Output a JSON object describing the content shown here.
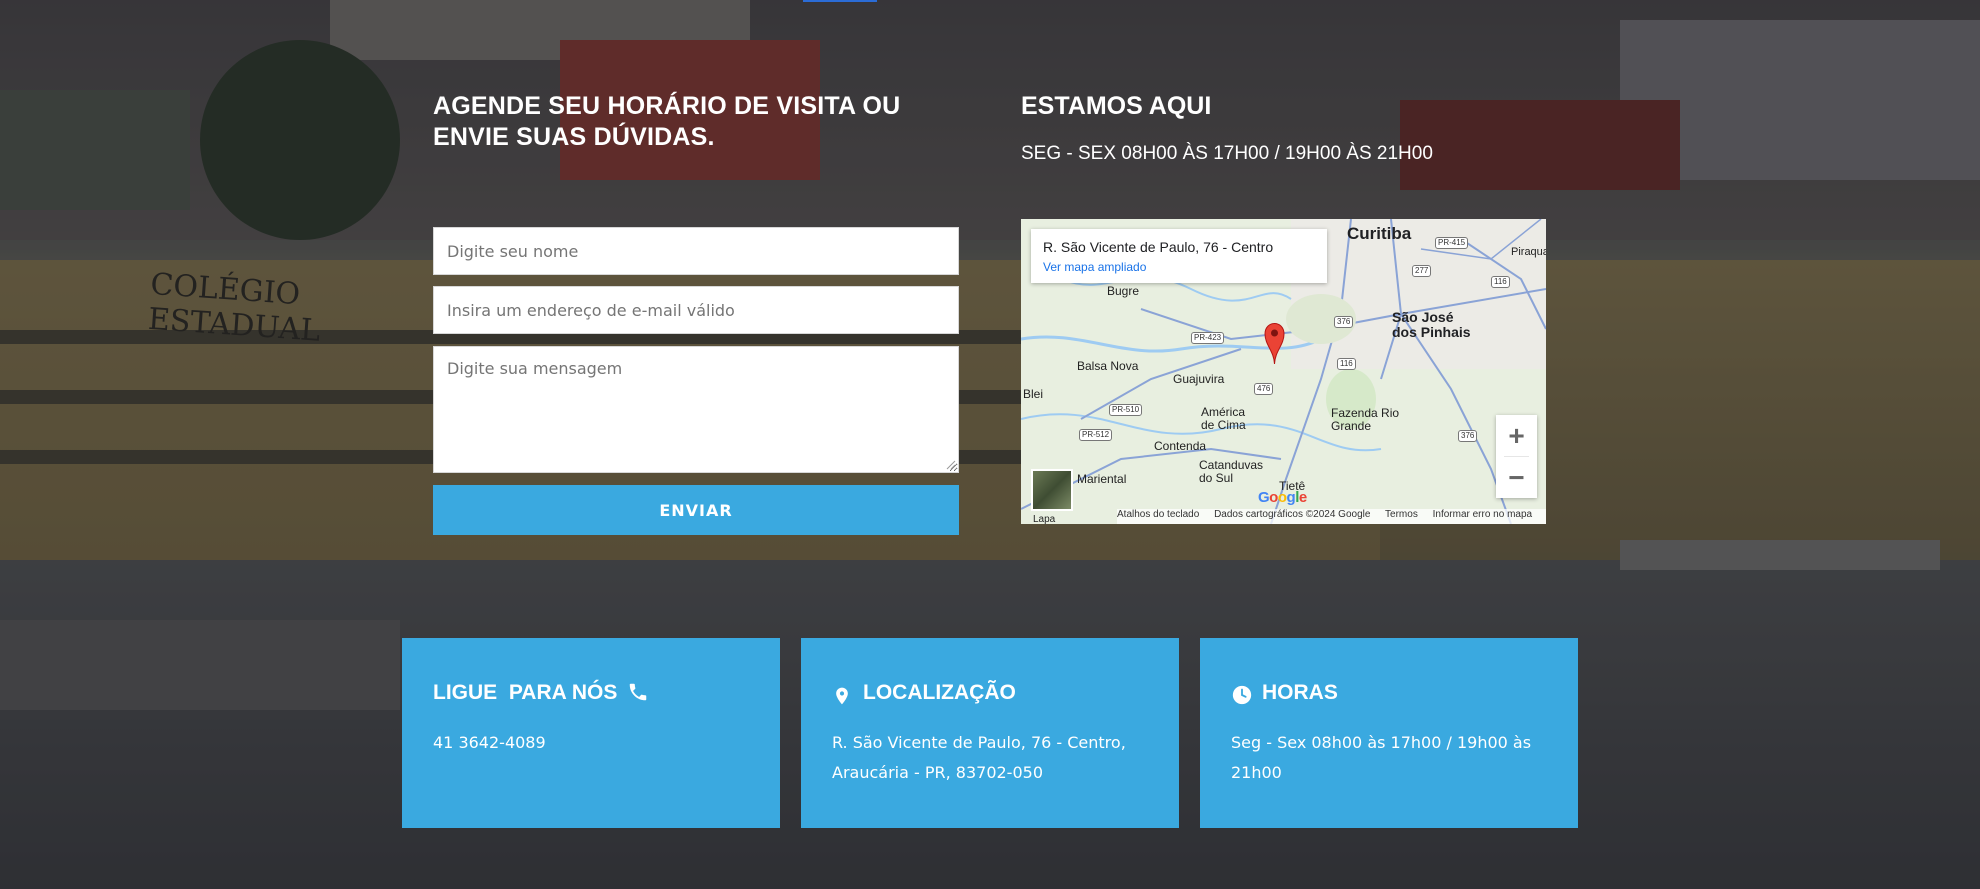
{
  "contact_form": {
    "heading": "AGENDE SEU HORÁRIO DE VISITA OU ENVIE SUAS DÚVIDAS.",
    "name_placeholder": "Digite seu nome",
    "email_placeholder": "Insira um endereço de e-mail válido",
    "message_placeholder": "Digite sua mensagem",
    "submit_label": "ENVIAR"
  },
  "location_section": {
    "heading": "ESTAMOS AQUI",
    "hours": "SEG - SEX 08H00 ÀS 17H00 / 19H00 ÀS 21H00"
  },
  "map": {
    "place_address": "R. São Vicente de Paulo, 76 - Centro",
    "enlarge_link": "Ver mapa ampliado",
    "zoom_in": "+",
    "zoom_out": "−",
    "labels": {
      "curitiba": "Curitiba",
      "sao_jose": "São José dos Pinhais",
      "bugre": "Bugre",
      "balsa_nova": "Balsa Nova",
      "guajuvira": "Guajuvira",
      "blei": "Blei",
      "america": "América de Cima",
      "fazenda": "Fazenda Rio Grande",
      "contenda": "Contenda",
      "mariental": "Mariental",
      "catanduvas": "Catanduvas do Sul",
      "tiete": "Tietê",
      "lapa": "Lapa",
      "piraqua": "Piraqua"
    },
    "shields": [
      "PR-415",
      "277",
      "116",
      "376",
      "PR-423",
      "116",
      "476",
      "PR-510",
      "PR-512",
      "376"
    ],
    "google_logo": "Google",
    "footer": {
      "shortcuts": "Atalhos do teclado",
      "map_data": "Dados cartográficos ©2024 Google",
      "terms": "Termos",
      "report": "Informar erro no mapa"
    },
    "colors": {
      "pin": "#ea4335",
      "water": "#9ecbf2",
      "roads": "#8aa3d6"
    }
  },
  "info_cards": [
    {
      "title": "LIGUE  PARA NÓS",
      "icon": "phone-icon",
      "text": "41 3642-4089"
    },
    {
      "title": "LOCALIZAÇÃO",
      "icon": "map-pin-icon",
      "text": "R. São Vicente de Paulo, 76 - Centro, Araucária - PR, 83702-050"
    },
    {
      "title": "HORAS",
      "icon": "clock-icon",
      "text": "Seg - Sex 08h00 às 17h00 /  19h00 às 21h00"
    }
  ],
  "colors": {
    "accent": "#3aa9e0",
    "text_on_dark": "#ffffff",
    "top_indicator": "#2b6cd6"
  }
}
